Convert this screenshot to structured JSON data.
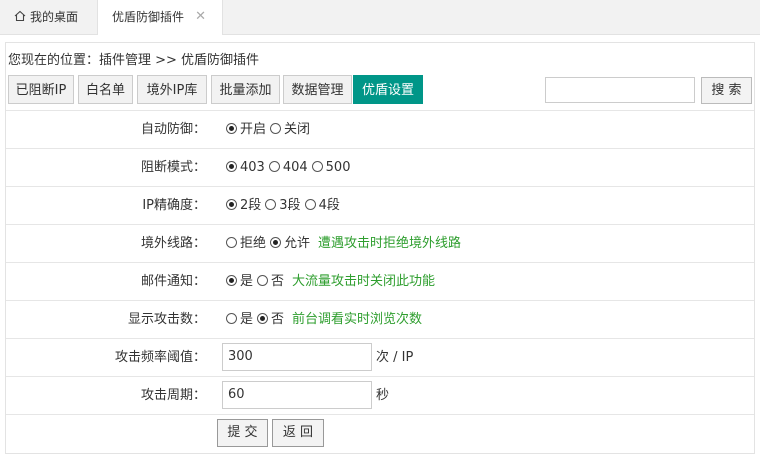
{
  "tabs": {
    "home": "我的桌面",
    "active": "优盾防御插件",
    "close": "✕"
  },
  "breadcrumb": "您现在的位置：插件管理 >> 优盾防御插件",
  "nav_buttons": [
    "已阻断IP",
    "白名单",
    "境外IP库",
    "批量添加",
    "数据管理",
    "优盾设置"
  ],
  "search": {
    "value": "",
    "button": "搜 索"
  },
  "settings": [
    {
      "label": "自动防御：",
      "options": [
        {
          "text": "开启",
          "checked": true
        },
        {
          "text": "关闭",
          "checked": false
        }
      ],
      "note": ""
    },
    {
      "label": "阻断模式：",
      "options": [
        {
          "text": "403",
          "checked": true
        },
        {
          "text": "404",
          "checked": false
        },
        {
          "text": "500",
          "checked": false
        }
      ],
      "note": ""
    },
    {
      "label": "IP精确度：",
      "options": [
        {
          "text": "2段",
          "checked": true
        },
        {
          "text": "3段",
          "checked": false
        },
        {
          "text": "4段",
          "checked": false
        }
      ],
      "note": ""
    },
    {
      "label": "境外线路：",
      "options": [
        {
          "text": "拒绝",
          "checked": false
        },
        {
          "text": "允许",
          "checked": true
        }
      ],
      "note": "遭遇攻击时拒绝境外线路"
    },
    {
      "label": "邮件通知：",
      "options": [
        {
          "text": "是",
          "checked": true
        },
        {
          "text": "否",
          "checked": false
        }
      ],
      "note": "大流量攻击时关闭此功能"
    },
    {
      "label": "显示攻击数：",
      "options": [
        {
          "text": "是",
          "checked": false
        },
        {
          "text": "否",
          "checked": true
        }
      ],
      "note": "前台调看实时浏览次数"
    }
  ],
  "threshold": {
    "label": "攻击频率阈值：",
    "value": "300",
    "unit": "次 / IP"
  },
  "period": {
    "label": "攻击周期：",
    "value": "60",
    "unit": "秒"
  },
  "actions": {
    "submit": "提 交",
    "back": "返 回"
  },
  "colors": {
    "accent": "#009688",
    "note": "#2e9e2e"
  }
}
